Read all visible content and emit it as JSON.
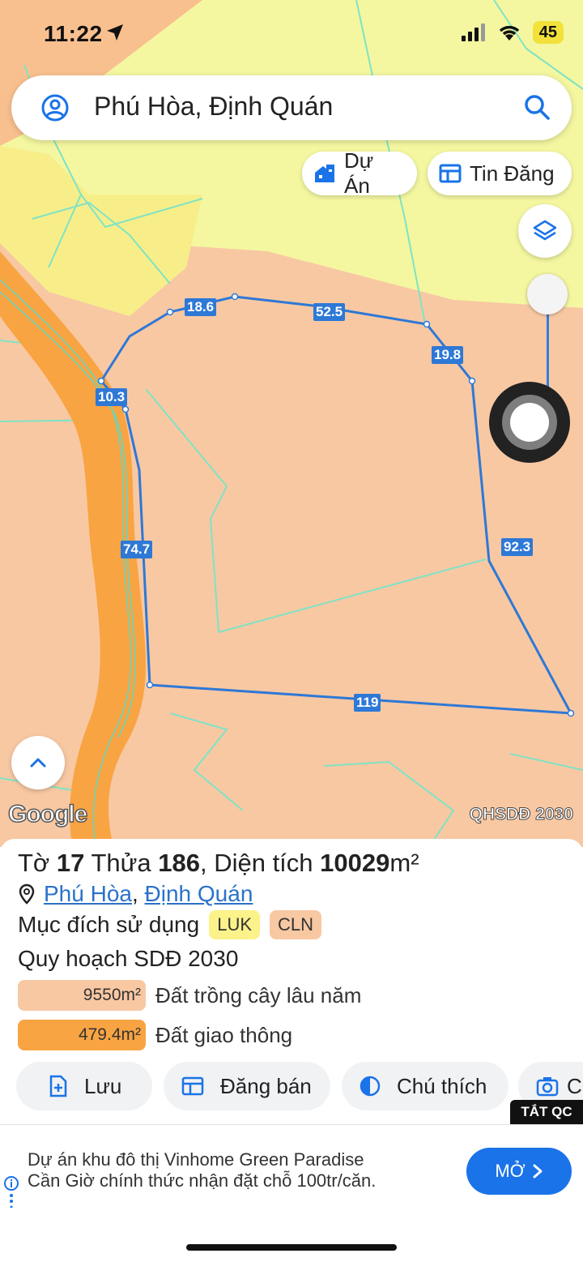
{
  "status_bar": {
    "time": "11:22",
    "battery": "45"
  },
  "search": {
    "query": "Phú Hòa, Định Quán"
  },
  "chips": {
    "du_an": "Dự Án",
    "tin_dang": "Tin Đăng"
  },
  "map": {
    "edge_lengths": [
      "18.6",
      "52.5",
      "19.8",
      "10.3",
      "74.7",
      "92.3",
      "119"
    ],
    "google_logo": "Google",
    "plan_tag": "QHSDĐ 2030"
  },
  "parcel": {
    "title_prefix_1": "Tờ",
    "sheet": "17",
    "title_prefix_2": "Thửa",
    "lot": "186",
    "title_prefix_3": ", Diện tích",
    "area": "10029",
    "area_unit": "m²",
    "ward": "Phú Hòa",
    "district": "Định Quán",
    "purpose_label": "Mục đích sử dụng",
    "purpose_tags": [
      {
        "code": "LUK",
        "color": "#fbf28a"
      },
      {
        "code": "CLN",
        "color": "#f8c8a3"
      }
    ],
    "plan_title": "Quy hoạch SDĐ 2030",
    "plan_items": [
      {
        "area": "9550m²",
        "label": "Đất trồng cây lâu năm",
        "color": "#f8c8a3"
      },
      {
        "area": "479.4m²",
        "label": "Đất giao thông",
        "color": "#f9a442"
      }
    ]
  },
  "actions": {
    "save": "Lưu",
    "sell": "Đăng bán",
    "legend": "Chú thích",
    "camera": "C"
  },
  "ad": {
    "close_label": "TẮT QC",
    "line1": "Dự án khu đô thị Vinhome Green Paradise",
    "line2": "Cần Giờ chính thức nhận đặt chỗ 100tr/căn.",
    "open_label": "MỞ"
  },
  "colors": {
    "accent": "#1a73e8",
    "parcel_line": "#2e78d6",
    "road": "#f9a442",
    "land": "#f8c8a3",
    "rice": "#f4f7a0"
  }
}
